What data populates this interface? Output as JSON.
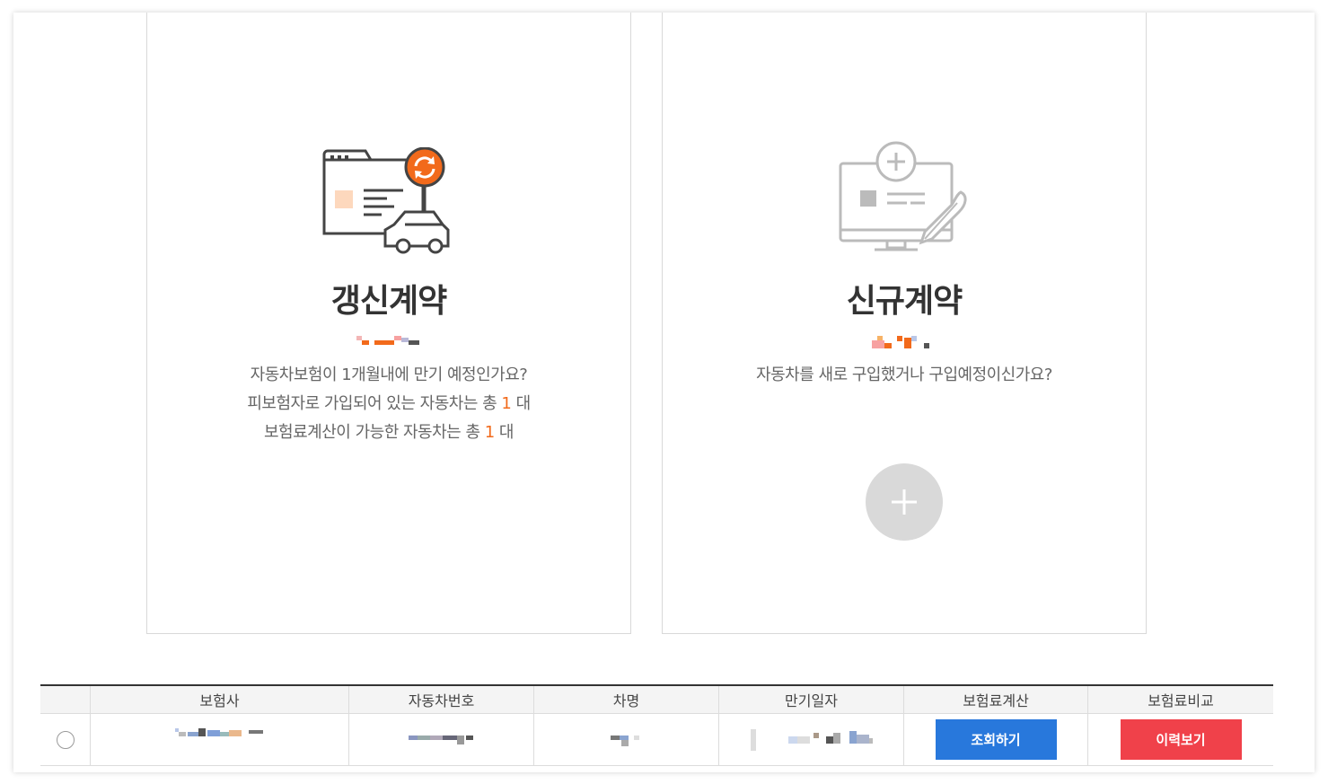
{
  "renew_card": {
    "title": "갱신계약",
    "line1": "자동차보험이 1개월내에 만기 예정인가요?",
    "line2_prefix": "피보험자로 가입되어 있는 자동차는 총 ",
    "line2_count": "1",
    "line2_suffix": " 대",
    "line3_prefix": "보험료계산이 가능한 자동차는 총 ",
    "line3_count": "1",
    "line3_suffix": " 대"
  },
  "new_card": {
    "title": "신규계약",
    "line1": "자동차를 새로 구입했거나 구입예정이신가요?",
    "add_symbol": "+"
  },
  "table": {
    "headers": [
      "보험사",
      "자동차번호",
      "차명",
      "만기일자",
      "보험료계산",
      "보험료비교"
    ],
    "row": {
      "calc_button": "조회하기",
      "compare_button": "이력보기"
    }
  },
  "colors": {
    "accent_orange": "#f26a1b",
    "button_blue": "#2878dc",
    "button_red": "#f0414a"
  },
  "icons": {
    "renew": "browser-car-refresh-icon",
    "new": "monitor-plus-feather-icon",
    "add": "plus-icon"
  }
}
